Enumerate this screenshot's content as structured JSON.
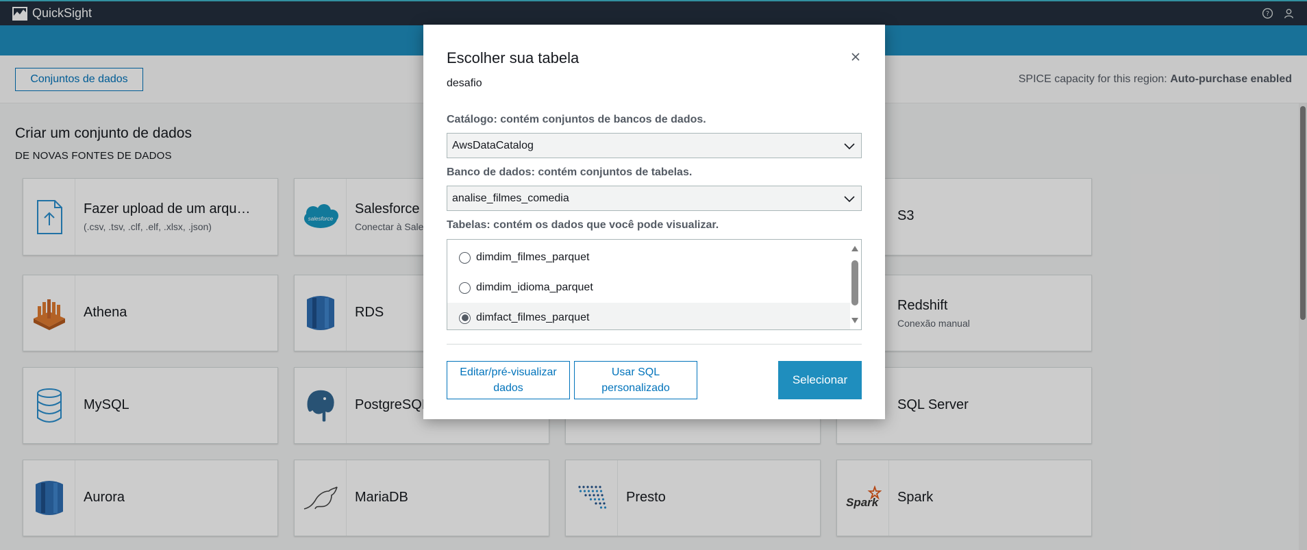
{
  "app": {
    "title": "QuickSight"
  },
  "topbar": {
    "help_icon": "help-circle-icon",
    "user_icon": "user-icon"
  },
  "subheader": {
    "datasets_button": "Conjuntos de dados",
    "spice_label": "SPICE capacity for this region: ",
    "spice_value": "Auto-purchase enabled"
  },
  "section": {
    "title": "Criar um conjunto de dados",
    "subtitle": "DE NOVAS FONTES DE DADOS"
  },
  "cards": [
    {
      "label": "Fazer upload de um arqu…",
      "sub": "(.csv, .tsv, .clf, .elf, .xlsx, .json)",
      "icon": "upload-file-icon"
    },
    {
      "label": "Salesforce",
      "sub": "Conectar à Sales",
      "icon": "salesforce-icon"
    },
    {
      "label": "S3",
      "sub": "",
      "icon": "s3-icon"
    },
    {
      "label": "Athena",
      "sub": "",
      "icon": "athena-icon"
    },
    {
      "label": "RDS",
      "sub": "",
      "icon": "rds-icon"
    },
    {
      "label": "Redshift",
      "sub": "Conexão manual",
      "icon": "redshift-icon"
    },
    {
      "label": "MySQL",
      "sub": "",
      "icon": "database-icon"
    },
    {
      "label": "PostgreSQL",
      "sub": "",
      "icon": "postgresql-icon"
    },
    {
      "label": "SQL Server",
      "sub": "",
      "icon": "sqlserver-icon"
    },
    {
      "label": "Aurora",
      "sub": "",
      "icon": "aurora-icon"
    },
    {
      "label": "MariaDB",
      "sub": "",
      "icon": "mariadb-icon"
    },
    {
      "label": "Presto",
      "sub": "",
      "icon": "presto-icon"
    },
    {
      "label": "Spark",
      "sub": "",
      "icon": "spark-icon"
    }
  ],
  "modal": {
    "title": "Escolher sua tabela",
    "subtitle": "desafio",
    "catalog_label": "Catálogo: contém conjuntos de bancos de dados.",
    "catalog_value": "AwsDataCatalog",
    "database_label": "Banco de dados: contém conjuntos de tabelas.",
    "database_value": "analise_filmes_comedia",
    "tables_label": "Tabelas: contém os dados que você pode visualizar.",
    "tables": [
      {
        "name": "dimdim_filmes_parquet",
        "selected": false
      },
      {
        "name": "dimdim_idioma_parquet",
        "selected": false
      },
      {
        "name": "dimfact_filmes_parquet",
        "selected": true
      }
    ],
    "edit_button": "Editar/pré-visualizar dados",
    "sql_button": "Usar SQL personalizado",
    "select_button": "Selecionar"
  },
  "colors": {
    "topbar": "#232f3e",
    "accent": "#1f8ebe",
    "link": "#0073bb"
  }
}
